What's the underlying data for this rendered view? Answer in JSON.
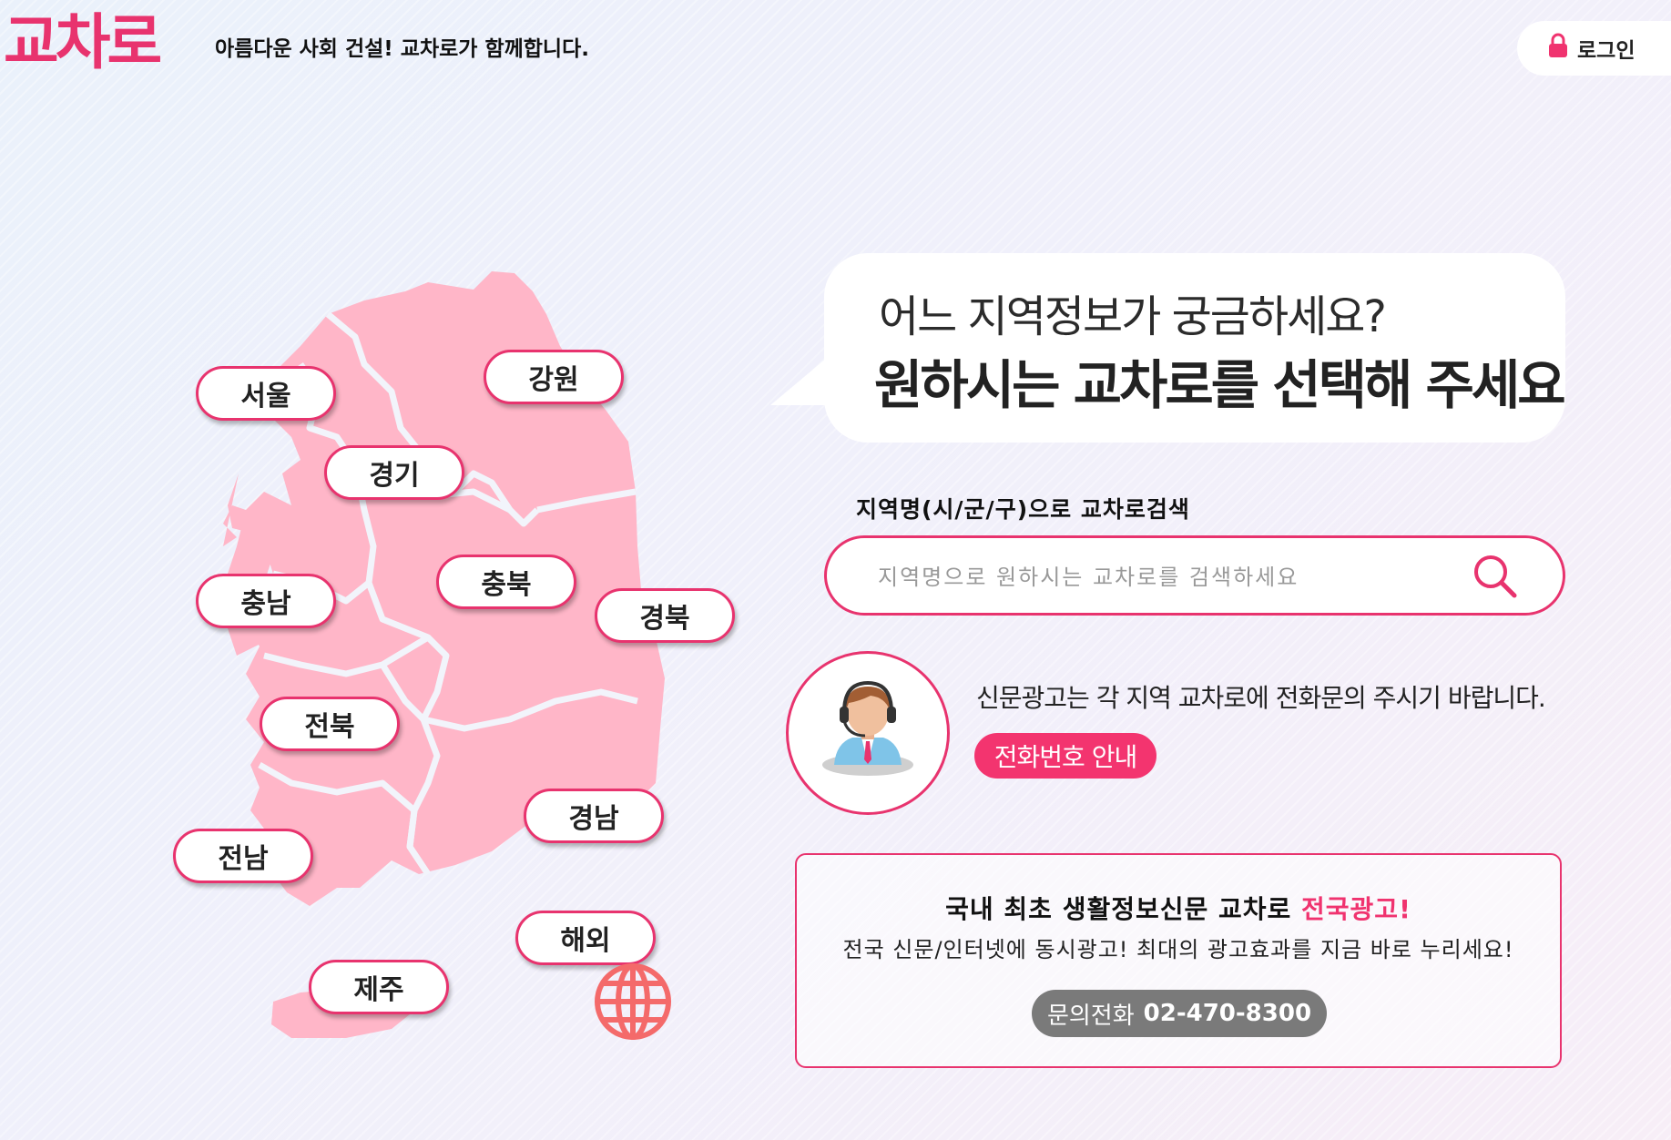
{
  "header": {
    "logo": "교차로",
    "slogan": "아름다운 사회 건설! 교차로가 함께합니다.",
    "login_label": "로그인"
  },
  "regions": {
    "seoul": "서울",
    "gangwon": "강원",
    "gyeonggi": "경기",
    "chungnam": "충남",
    "chungbuk": "충북",
    "gyeongbuk": "경북",
    "jeonbuk": "전북",
    "gyeongnam": "경남",
    "jeonnam": "전남",
    "overseas": "해외",
    "jeju": "제주"
  },
  "bubble": {
    "question": "어느 지역정보가 궁금하세요?",
    "instruction": "원하시는 교차로를 선택해 주세요"
  },
  "search": {
    "label": "지역명(시/군/구)으로 교차로검색",
    "placeholder": "지역명으로 원하시는 교차로를 검색하세요"
  },
  "support": {
    "text": "신문광고는 각 지역 교차로에 전화문의 주시기 바랍니다.",
    "button_label": "전화번호 안내"
  },
  "ad": {
    "title_main": "국내 최초 생활정보신문 교차로 ",
    "title_highlight": "전국광고!",
    "subtitle": "전국 신문/인터넷에 동시광고! 최대의 광고효과를 지금 바로 누리세요!",
    "call_label": "문의전화",
    "call_number": "02-470-8300"
  },
  "colors": {
    "brand_pink": "#e8336e",
    "map_fill": "#ffb6c8",
    "button_gray": "#7a7a7a"
  }
}
